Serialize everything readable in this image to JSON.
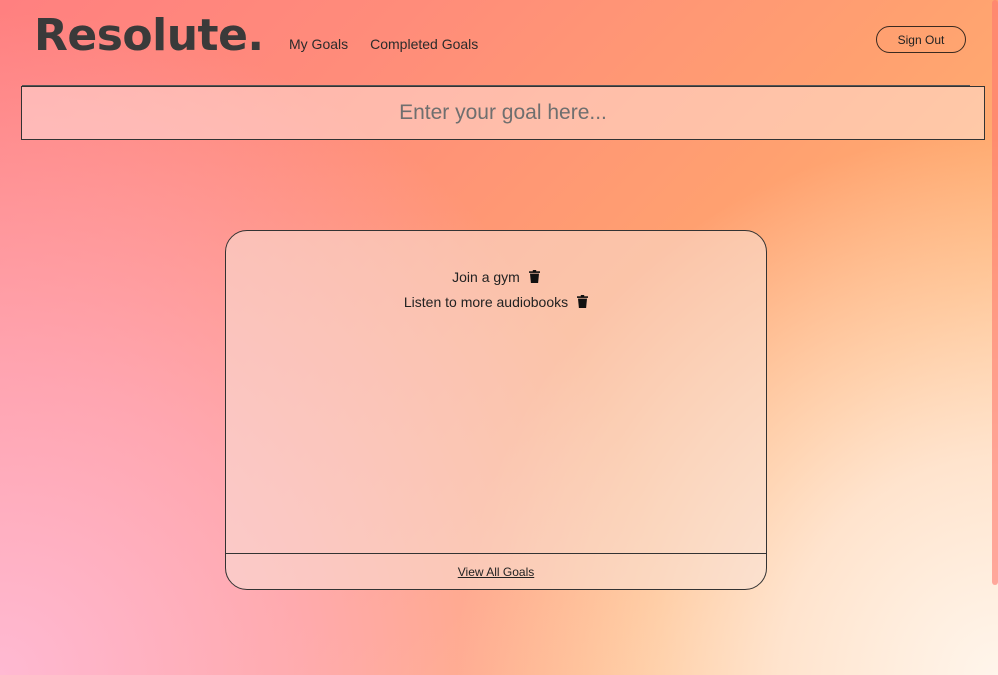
{
  "header": {
    "logo": "Resolute.",
    "nav": [
      {
        "label": "My Goals"
      },
      {
        "label": "Completed Goals"
      }
    ],
    "sign_out_label": "Sign Out"
  },
  "goal_input": {
    "placeholder": "Enter your goal here...",
    "value": ""
  },
  "goals_card": {
    "items": [
      {
        "text": "Join a gym",
        "icon": "trash-icon"
      },
      {
        "text": "Listen to more audiobooks",
        "icon": "trash-icon"
      }
    ],
    "footer_link": "View All Goals"
  },
  "colors": {
    "text_dark": "#3a3a3a",
    "gradient_start": "#ff8080",
    "gradient_end": "#ffc98a"
  }
}
